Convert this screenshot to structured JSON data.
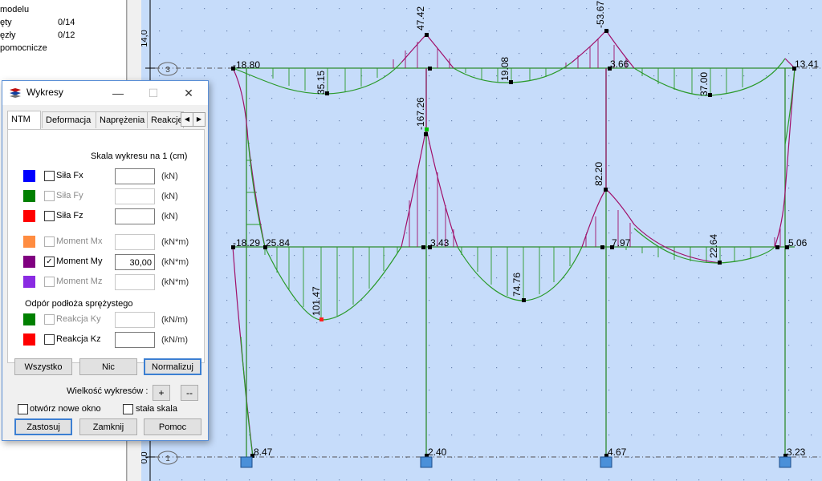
{
  "tree": {
    "rows": [
      {
        "label": "modelu",
        "value": ""
      },
      {
        "label": "ęty",
        "value": "0/14"
      },
      {
        "label": "ęzły",
        "value": "0/12"
      },
      {
        "label": "pomocnicze",
        "value": ""
      }
    ]
  },
  "dialog": {
    "title": "Wykresy",
    "tabs": [
      "NTM",
      "Deformacja",
      "Naprężenia",
      "Reakcje"
    ],
    "scale_label": "Skala wykresu na 1  (cm)",
    "rows": [
      {
        "color": "#0000ff",
        "label": "Siła Fx",
        "checked": false,
        "enabled": true,
        "value": "",
        "unit": "(kN)"
      },
      {
        "color": "#008000",
        "label": "Siła Fy",
        "checked": false,
        "enabled": false,
        "value": "",
        "unit": "(kN)"
      },
      {
        "color": "#ff0000",
        "label": "Siła Fz",
        "checked": false,
        "enabled": true,
        "value": "",
        "unit": "(kN)"
      },
      {
        "color": "#ff8c40",
        "label": "Moment Mx",
        "checked": false,
        "enabled": false,
        "value": "",
        "unit": "(kN*m)"
      },
      {
        "color": "#800080",
        "label": "Moment My",
        "checked": true,
        "enabled": true,
        "value": "30,00",
        "unit": "(kN*m)"
      },
      {
        "color": "#8a2be2",
        "label": "Moment Mz",
        "checked": false,
        "enabled": false,
        "value": "",
        "unit": "(kN*m)"
      }
    ],
    "support_section": "Odpór podłoża sprężystego",
    "support_rows": [
      {
        "color": "#008000",
        "label": "Reakcja Ky",
        "checked": false,
        "enabled": false,
        "value": "",
        "unit": "(kN/m)"
      },
      {
        "color": "#ff0000",
        "label": "Reakcja Kz",
        "checked": false,
        "enabled": true,
        "value": "",
        "unit": "(kN/m)"
      }
    ],
    "buttons": {
      "all": "Wszystko",
      "none": "Nic",
      "normalize": "Normalizuj",
      "apply": "Zastosuj",
      "close": "Zamknij",
      "help": "Pomoc"
    },
    "size_label": "Wielkość wykresów :",
    "size_plus": "+",
    "size_minus": "--",
    "open_new_window": "otwórz nowe okno",
    "const_scale": "stała  skala"
  },
  "diagram": {
    "axis_ticks": [
      "14,0",
      "0,0"
    ],
    "level_markers": [
      "3",
      "1"
    ],
    "labels": [
      "-18.80",
      "47.42",
      "-53.67",
      "3.66",
      "13.41",
      "35.15",
      "19.08",
      "37.00",
      "-167.26",
      "82.20",
      "-18.29",
      "25.84",
      "3.43",
      "7.97",
      "5.06",
      "22.64",
      "74.76",
      "101.47",
      "8.47",
      "2.40",
      "4.67",
      "3.23"
    ],
    "colors": {
      "background": "#c6dcfa",
      "beam": "#2e8b2e",
      "diagram_green": "#2a9a2a",
      "diagram_purple": "#a0106a",
      "support": "#4a90d9"
    }
  }
}
